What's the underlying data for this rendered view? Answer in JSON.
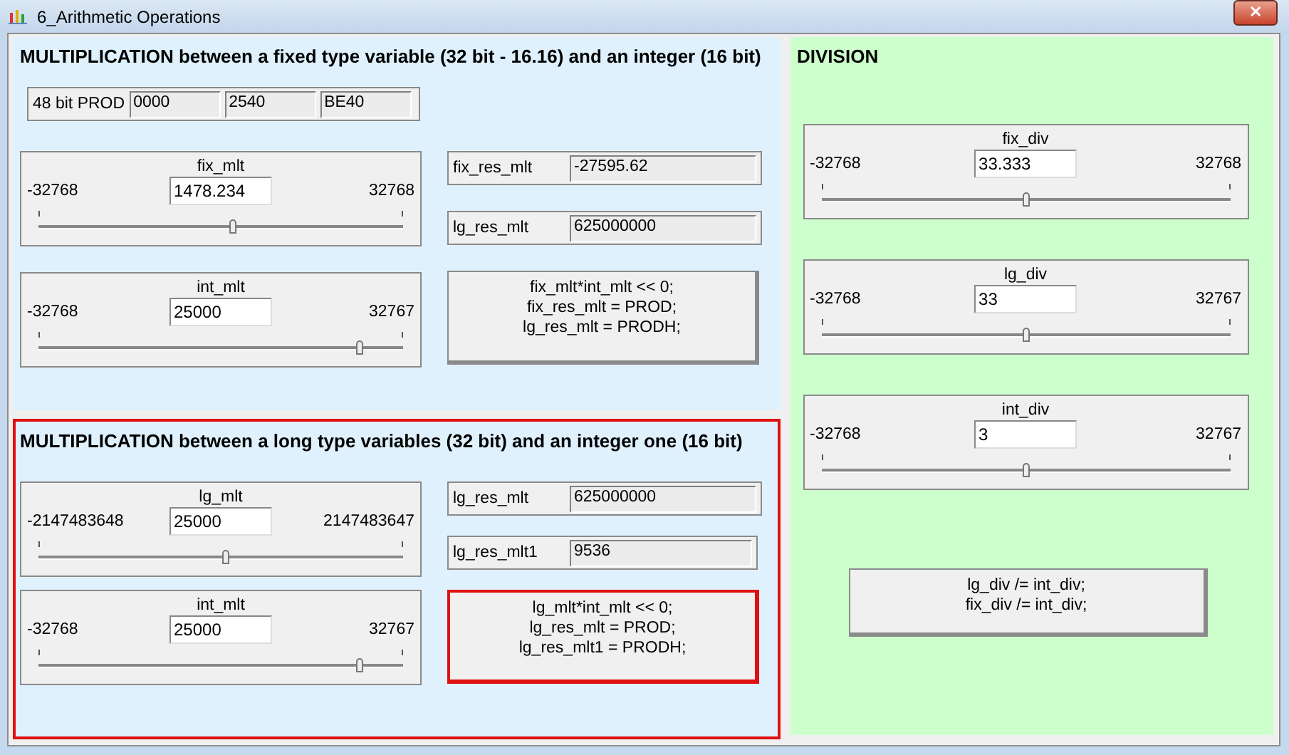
{
  "window": {
    "title": "6_Arithmetic Operations",
    "close": "✕"
  },
  "sections": [
    {
      "title": "MULTIPLICATION between a fixed type variable (32 bit - 16.16) and an integer (16 bit)",
      "highlighted": false,
      "prod": {
        "label": "48 bit PROD",
        "fields": [
          "0000",
          "2540",
          "BE40"
        ]
      },
      "sliders": [
        {
          "name": "fix_mlt",
          "min": "-32768",
          "max": "32768",
          "value": "1478.234",
          "level": 0.53
        },
        {
          "name": "int_mlt",
          "min": "-32768",
          "max": "32767",
          "value": "25000",
          "level": 0.88
        }
      ],
      "readouts": [
        {
          "label": "fix_res_mlt",
          "value": "-27595.62"
        },
        {
          "label": "lg_res_mlt",
          "value": "625000000"
        }
      ],
      "code_button": {
        "lines": [
          "fix_mlt*int_mlt << 0;",
          "fix_res_mlt = PROD;",
          "lg_res_mlt = PRODH;"
        ],
        "highlighted": false
      }
    },
    {
      "title": "MULTIPLICATION between a long type variables (32 bit) and an integer one (16 bit)",
      "highlighted": true,
      "sliders": [
        {
          "name": "lg_mlt",
          "min": "-2147483648",
          "max": "2147483647",
          "value": "25000",
          "level": 0.51
        },
        {
          "name": "int_mlt",
          "min": "-32768",
          "max": "32767",
          "value": "25000",
          "level": 0.88
        }
      ],
      "readouts": [
        {
          "label": "lg_res_mlt",
          "value": "625000000"
        },
        {
          "label": "lg_res_mlt1",
          "value": "9536"
        }
      ],
      "code_button": {
        "lines": [
          "lg_mlt*int_mlt << 0;",
          "lg_res_mlt = PROD;",
          "lg_res_mlt1 = PRODH;"
        ],
        "highlighted": true
      }
    }
  ],
  "division": {
    "title": "DIVISION",
    "sliders": [
      {
        "name": "fix_div",
        "min": "-32768",
        "max": "32768",
        "value": "33.333",
        "level": 0.5
      },
      {
        "name": "lg_div",
        "min": "-32768",
        "max": "32767",
        "value": "33",
        "level": 0.5
      },
      {
        "name": "int_div",
        "min": "-32768",
        "max": "32767",
        "value": "3",
        "level": 0.5
      }
    ],
    "code_button": {
      "lines": [
        "lg_div /= int_div;",
        "fix_div /= int_div;"
      ],
      "highlighted": false
    }
  }
}
